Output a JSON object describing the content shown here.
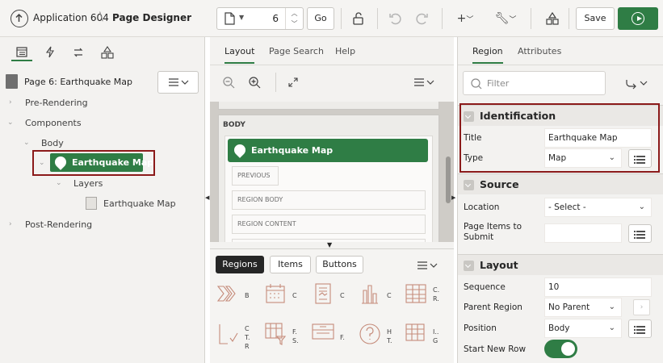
{
  "header": {
    "app_name": "Application 604",
    "breadcrumb_separator": "\\",
    "page_designer": "Page Designer",
    "page_number": "6",
    "go_label": "Go",
    "save_label": "Save"
  },
  "left_pane": {
    "page_title": "Page 6: Earthquake Map",
    "tree": {
      "pre_rendering": "Pre-Rendering",
      "components": "Components",
      "body": "Body",
      "selected_region": "Earthquake Map",
      "layers": "Layers",
      "layer_item": "Earthquake Map",
      "post_rendering": "Post-Rendering"
    }
  },
  "center_pane": {
    "tabs": [
      "Layout",
      "Page Search",
      "Help"
    ],
    "body_label": "BODY",
    "region_title": "Earthquake Map",
    "slots": [
      "PREVIOUS",
      "REGION BODY",
      "REGION CONTENT"
    ],
    "gallery_tabs": [
      "Regions",
      "Items",
      "Buttons"
    ],
    "gallery_items": [
      {
        "label": "B"
      },
      {
        "label": "C"
      },
      {
        "label": "C"
      },
      {
        "label": "C"
      },
      {
        "label": "C.\nR."
      },
      {
        "label": "C\nT.\nR"
      },
      {
        "label": "F.\nS."
      },
      {
        "label": "F."
      },
      {
        "label": "H\nT."
      },
      {
        "label": "I..\nG"
      }
    ]
  },
  "right_pane": {
    "tabs": [
      "Region",
      "Attributes"
    ],
    "filter_placeholder": "Filter",
    "sections": {
      "identification": "Identification",
      "source": "Source",
      "layout": "Layout"
    },
    "properties": {
      "title_label": "Title",
      "title_value": "Earthquake Map",
      "type_label": "Type",
      "type_value": "Map",
      "location_label": "Location",
      "location_value": "- Select -",
      "page_items_label": "Page Items to Submit",
      "sequence_label": "Sequence",
      "sequence_value": "10",
      "parent_region_label": "Parent Region",
      "parent_region_value": "No Parent",
      "position_label": "Position",
      "position_value": "Body",
      "start_new_row_label": "Start New Row",
      "start_new_row_on": true
    }
  },
  "colors": {
    "accent_green": "#2f7d45",
    "highlight_red": "#8b1a1a"
  },
  "icons": [
    "up-arrow-circle-icon",
    "document-icon",
    "unlock-icon",
    "undo-icon",
    "redo-icon",
    "plus-icon",
    "wrench-icon",
    "shared-components-icon",
    "run-icon",
    "rendering-tree-icon",
    "dynamic-actions-icon",
    "processing-icon",
    "shared-icon",
    "zoom-out-icon",
    "zoom-in-icon",
    "expand-icon",
    "hamburger-icon",
    "search-icon",
    "go-to-group-icon",
    "map-pin-icon",
    "list-icon"
  ]
}
